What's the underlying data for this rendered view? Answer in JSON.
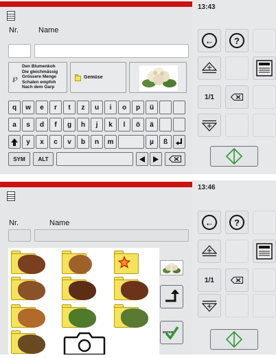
{
  "screen1": {
    "clock": "13:43",
    "nr_label": "Nr.",
    "name_label": "Name",
    "nr_value": "",
    "name_value": "",
    "description_lines": [
      "Den Blumenkoh",
      "Die gleichmässig",
      "Grössere Menge",
      "Schalen empfoh",
      "Nach dem Garp"
    ],
    "category_label": "Gemüse",
    "keyboard": {
      "row1": [
        "q",
        "w",
        "e",
        "r",
        "t",
        "z",
        "u",
        "i",
        "o",
        "p",
        "ü"
      ],
      "row2": [
        "a",
        "s",
        "d",
        "f",
        "g",
        "h",
        "j",
        "k",
        "l",
        "ö",
        "ä"
      ],
      "row3": [
        "y",
        "x",
        "c",
        "v",
        "b",
        "n",
        "m",
        "µ",
        "ß"
      ],
      "sym": "SYM",
      "alt": "ALT"
    },
    "page_indicator": "1/1"
  },
  "screen2": {
    "clock": "13:46",
    "nr_label": "Nr.",
    "name_label": "Name",
    "nr_value": "",
    "name_value": "",
    "page_indicator": "1/1",
    "enter_label": "ENTER"
  },
  "colors": {
    "header_red": "#cc1111",
    "accent_green": "#2e9a2e",
    "folder_yellow": "#f5e35a"
  },
  "icons": [
    "document-icon",
    "back-icon",
    "help-icon",
    "page-up-icon",
    "page-down-icon",
    "list-view-icon",
    "backspace-icon",
    "start-icon",
    "camera-icon",
    "return-icon",
    "checkmark-icon",
    "pin-icon",
    "folder-icon"
  ]
}
